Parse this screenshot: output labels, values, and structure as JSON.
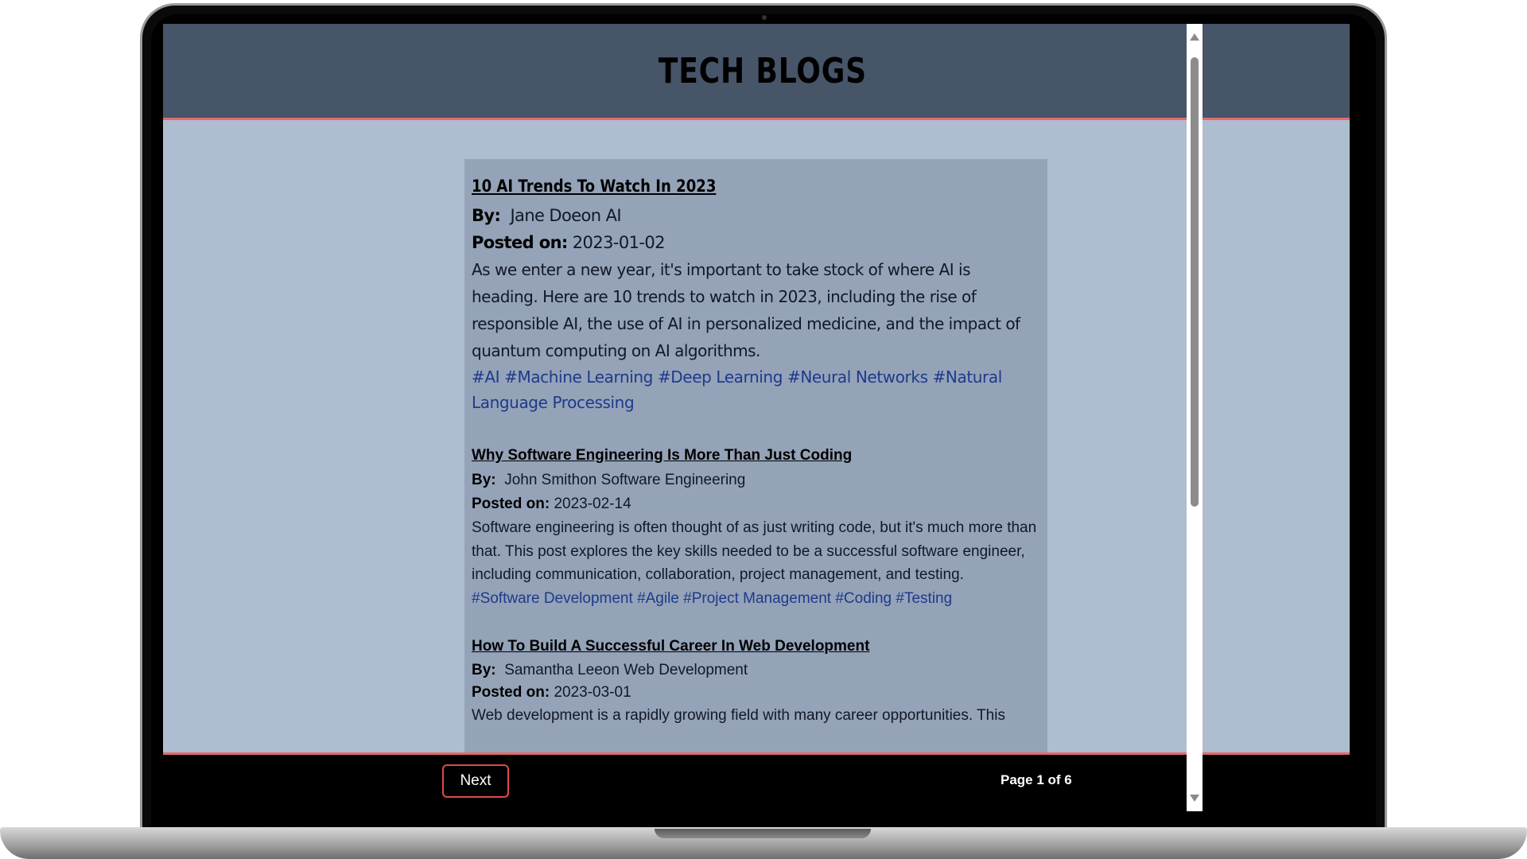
{
  "header": {
    "title": "TECH BLOGS"
  },
  "labels": {
    "by": "By:",
    "posted_on": "Posted on:"
  },
  "posts": [
    {
      "title": "10 AI Trends To Watch In 2023",
      "author": "Jane Doeon AI",
      "date": "2023-01-02",
      "body": "As we enter a new year, it's important to take stock of where AI is heading. Here are 10 trends to watch in 2023, including the rise of responsible AI, the use of AI in personalized medicine, and the impact of quantum computing on AI algorithms.",
      "tags": [
        "#AI",
        "#Machine Learning",
        "#Deep Learning",
        "#Neural Networks",
        "#Natural Language Processing"
      ]
    },
    {
      "title": "Why Software Engineering Is More Than Just Coding",
      "author": "John Smithon Software Engineering",
      "date": "2023-02-14",
      "body": "Software engineering is often thought of as just writing code, but it's much more than that. This post explores the key skills needed to be a successful software engineer, including communication, collaboration, project management, and testing.",
      "tags": [
        "#Software Development",
        "#Agile",
        "#Project Management",
        "#Coding",
        "#Testing"
      ]
    },
    {
      "title": "How To Build A Successful Career In Web Development",
      "author": "Samantha Leeon Web Development",
      "date": "2023-03-01",
      "body": "Web development is a rapidly growing field with many career opportunities. This",
      "tags": []
    }
  ],
  "footer": {
    "next_label": "Next",
    "page_indicator": "Page 1 of 6"
  },
  "colors": {
    "header_bg": "#475569",
    "accent": "#e36a6a",
    "page_bg": "#aebdd0",
    "panel_bg": "#94a3b8",
    "tag_color": "#1e3a8a",
    "footer_bg": "#000000"
  },
  "icons": {
    "scroll_up": "triangle-up-icon",
    "scroll_down": "triangle-down-icon"
  }
}
